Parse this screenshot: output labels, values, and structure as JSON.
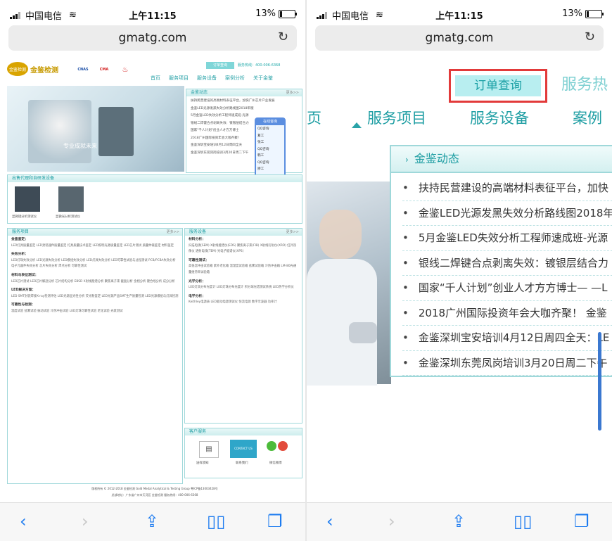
{
  "status": {
    "carrier": "中国电信",
    "time": "上午11:15",
    "battery": "13%",
    "battery_level": 0.13
  },
  "browser": {
    "url": "gmatg.com"
  },
  "left_page": {
    "logo_text": "金鉴检测",
    "seal_text": "金鉴检测",
    "certs": [
      "CNAS",
      "CMA",
      "CNAS"
    ],
    "order_query": "订单查询",
    "hotline": "服务热线：400-006-6368",
    "nav": [
      "首页",
      "服务项目",
      "服务设备",
      "案例分析",
      "关于金鉴"
    ],
    "banner_text": "专业成就未来",
    "news": {
      "title": "金鉴动态",
      "more": "更多>>",
      "items": [
        "扶持民营建设的高端材料表征平台，加快广州芯片产业发展",
        "金鉴LED光源发黑失效分析路线图2018年版",
        "5月金鉴LED失效分析工程师速成班-光源",
        "银线二焊键合点剥离失效：镀银层结合力",
        "国家\"千人计划\"创业人才方方博士",
        "2018广州国际投资年会大咖齐聚！",
        "金鉴深圳宝安培训4月12日周四全天",
        "金鉴深圳东莞凤岗培训3月20日周二下午"
      ]
    },
    "chat": {
      "title": "在线咨询",
      "items": [
        "QQ咨询",
        "葛工",
        "张工",
        "QQ咨询",
        "韩工",
        "QQ咨询",
        "廖工"
      ]
    },
    "cases_title": "出售代理和自研发设备",
    "case_items": [
      "显微镜分析测试仪",
      "显微光分析测试仪"
    ],
    "service": {
      "title": "服务项目",
      "more": "更多>>",
      "groups": [
        {
          "head": "金鉴鉴定：",
          "text": "LED灯具质量鉴定  LED封装器件质量鉴定  灯具质量技术鉴定  LED照明光源质量鉴定  LED芯片测试  质量仲裁鉴定  材料鉴定"
        },
        {
          "head": "失效分析：",
          "text": "LED灯珠失效分析  LED光源失效分析  LED模组失效分析  LED灯具失效分析  LED可靠性试验与过程测试  PCB/PCBA失效分析  电子元器件失效分析  芯片失效分析  焊点分析  可靠性测试"
        },
        {
          "head": "材料与表征测试：",
          "text": "LED芯片测试  LED芯片解剖分析  芯片结构分析  EBSD  X射线能谱分析  聚焦离子束  截面分析  金相分析  键合线分析  成分分析"
        },
        {
          "head": "LED解决方案：",
          "text": "LED SMT封装焊接X-ray检测评估  LED光源显光性分析  荧光粉鉴定  LED光源产品SMT生产质量检测  LED光源模组与灯具检测"
        },
        {
          "head": "可靠性与检测：",
          "text": "温度试验  盐雾试验  振动试验  冷热冲击试验  LED灯珠可靠性试验  老化试验  光衰测试"
        }
      ]
    },
    "equipment": {
      "title": "服务设备",
      "more": "更多>>",
      "groups": [
        {
          "head": "材料分析：",
          "text": "扫描电镜(SEM)  X射线能谱仪(EDS)  聚焦离子束(FIB)  X射线衍射仪(XRD)  红外热像仪  透射电镜(TEM)  光电子能谱仪(XPS)"
        },
        {
          "head": "可靠性测试：",
          "text": "高低温冲击试验箱  紫外老化箱  温湿度试验箱  盐雾试验箱  冷热冲击箱  LM-80光通量维持率试验箱"
        },
        {
          "head": "光学分析：",
          "text": "LED灯具分布光度计  LED灯珠分布光度计  积分球光谱测试系统  LED热学分析仪"
        },
        {
          "head": "电学分析：",
          "text": "Keithley电源表  LED驱动电源测试仪  恒流电源  数字示波器  功率计"
        }
      ]
    },
    "customer": {
      "title": "客户服务",
      "items": [
        "送样须知",
        "联系我们",
        "微信微博"
      ],
      "contact_label": "CONTACT US"
    },
    "footer_lines": [
      "版权所有 © 2012-2018 金鉴检测 Gold Medal Analytical & Testing Group 粤ICP备13003428号",
      "总部地址：广东省广州市天河区  金鉴检测  服务热线：400-006-6368"
    ]
  },
  "right_page": {
    "order_query": "订单查询",
    "hotline_partial": "服务热",
    "nav": [
      "页",
      "服务项目",
      "服务设备",
      "案例"
    ],
    "news": {
      "title": "金鉴动态",
      "items": [
        "扶持民营建设的高端材料表征平台，加快",
        "金鉴LED光源发黑失效分析路线图2018年",
        "5月金鉴LED失效分析工程师速成班-光源",
        "银线二焊键合点剥离失效：镀银层结合力",
        "国家“千人计划”创业人才方方博士— —L",
        "2018广州国际投资年会大咖齐聚！ 金鉴",
        "金鉴深圳宝安培训4月12日周四全天：LE",
        "金鉴深圳东莞凤岗培训3月20日周二下午"
      ]
    }
  },
  "colors": {
    "accent": "#1f9ea3",
    "highlight_box": "#e23a3a",
    "ios_blue": "#1e7cf0",
    "panel_border": "#9fd8da"
  }
}
